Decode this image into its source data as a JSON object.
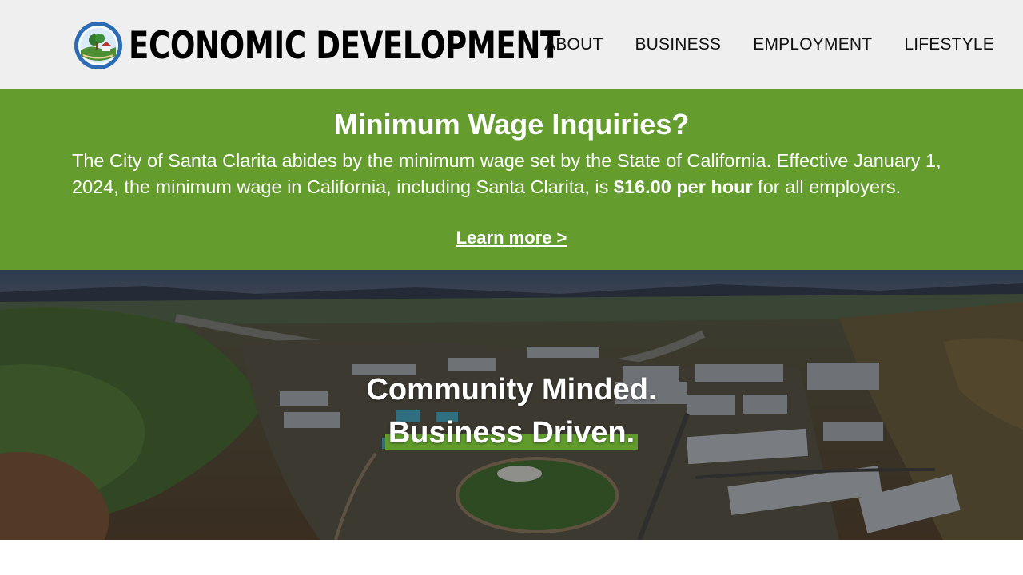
{
  "header": {
    "title": "ECONOMIC DEVELOPMENT",
    "logo_icon": "city-seal-icon",
    "nav": [
      {
        "label": "ABOUT"
      },
      {
        "label": "BUSINESS"
      },
      {
        "label": "EMPLOYMENT"
      },
      {
        "label": "LIFESTYLE"
      }
    ]
  },
  "alert": {
    "title": "Minimum Wage Inquiries?",
    "body_prefix": "The City of Santa Clarita abides by the minimum wage set by the State of California. Effective January 1, 2024, the minimum wage in California, including Santa Clarita, is ",
    "body_bold": "$16.00 per hour",
    "body_suffix": " for all employers.",
    "link_label": "Learn more >"
  },
  "hero": {
    "line1": "Community Minded.",
    "line2": "Business Driven."
  },
  "colors": {
    "header_bg": "#efefef",
    "banner_green": "#649c2d",
    "highlight_green": "#5f9c2c"
  }
}
